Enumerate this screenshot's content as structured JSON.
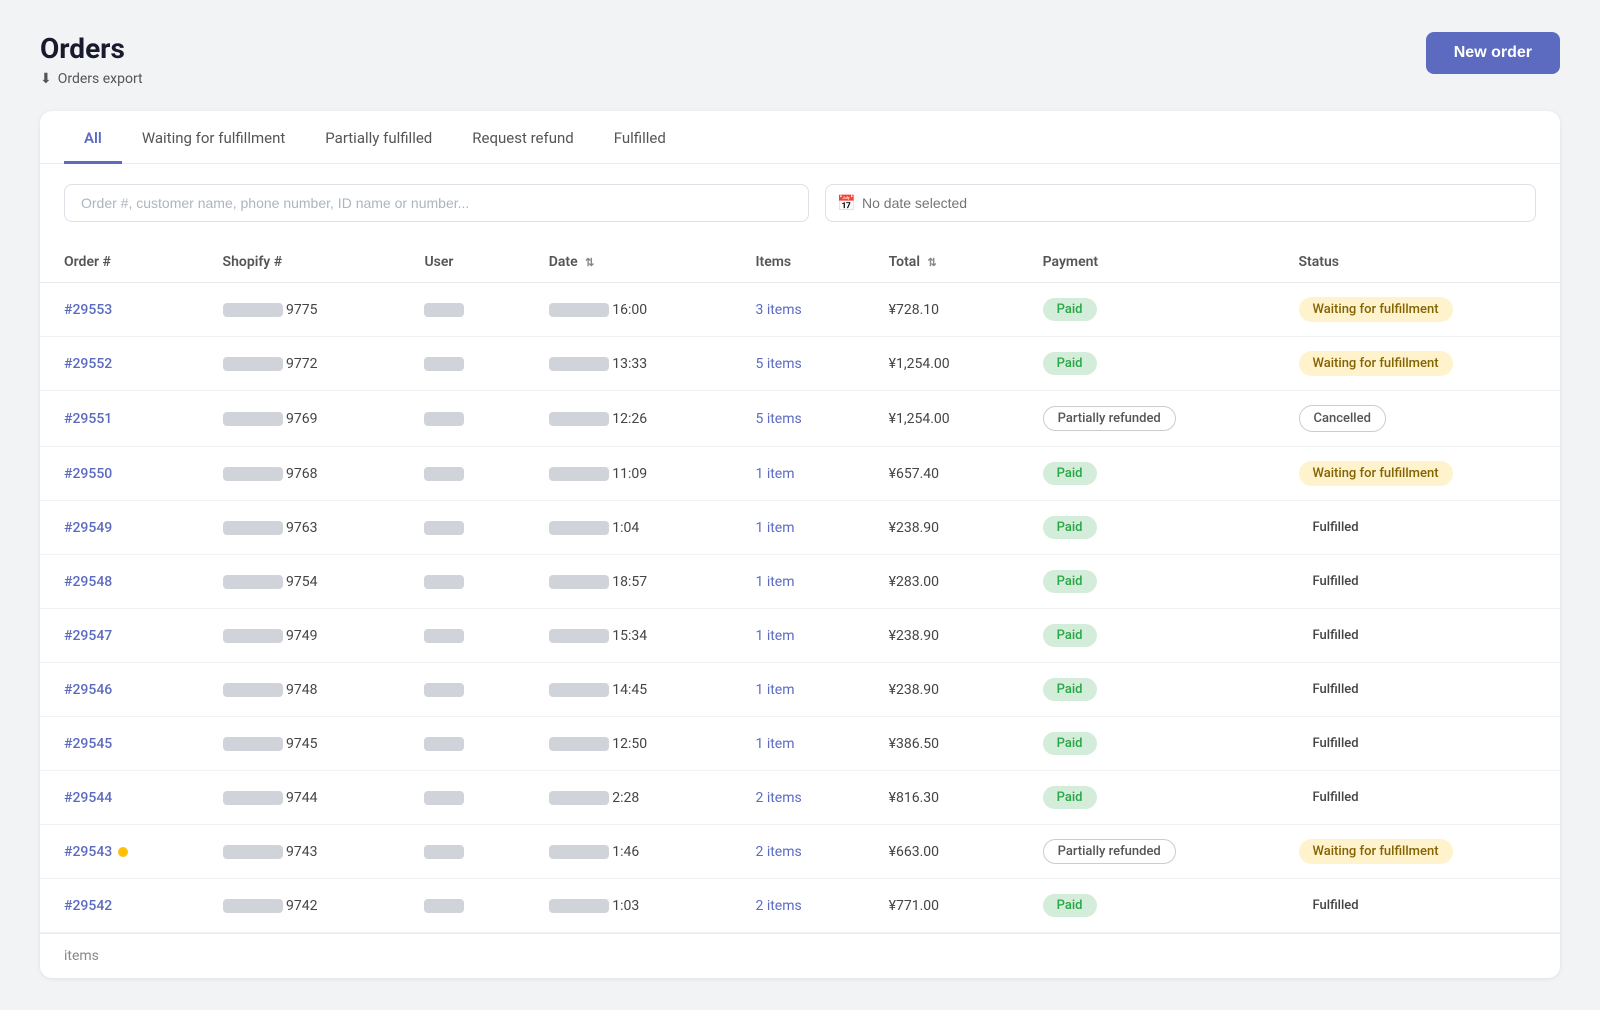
{
  "page": {
    "title": "Orders",
    "export_label": "Orders export",
    "new_order_label": "New order"
  },
  "tabs": [
    {
      "id": "all",
      "label": "All",
      "active": true
    },
    {
      "id": "waiting",
      "label": "Waiting for fulfillment",
      "active": false
    },
    {
      "id": "partial",
      "label": "Partially fulfilled",
      "active": false
    },
    {
      "id": "refund",
      "label": "Request refund",
      "active": false
    },
    {
      "id": "fulfilled",
      "label": "Fulfilled",
      "active": false
    }
  ],
  "filters": {
    "search_placeholder": "Order #, customer name, phone number, ID name or number...",
    "date_placeholder": "No date selected"
  },
  "table": {
    "columns": [
      {
        "id": "order",
        "label": "Order #",
        "sortable": false
      },
      {
        "id": "shopify",
        "label": "Shopify #",
        "sortable": false
      },
      {
        "id": "user",
        "label": "User",
        "sortable": false
      },
      {
        "id": "date",
        "label": "Date",
        "sortable": true
      },
      {
        "id": "items",
        "label": "Items",
        "sortable": false
      },
      {
        "id": "total",
        "label": "Total",
        "sortable": true
      },
      {
        "id": "payment",
        "label": "Payment",
        "sortable": false
      },
      {
        "id": "status",
        "label": "Status",
        "sortable": false
      }
    ],
    "rows": [
      {
        "order": "#29553",
        "shopify_suffix": "9775",
        "time": "16:00",
        "items": "3 items",
        "total": "¥728.10",
        "payment": "Paid",
        "payment_type": "paid",
        "status": "Waiting for fulfillment",
        "status_type": "waiting",
        "badge": false
      },
      {
        "order": "#29552",
        "shopify_suffix": "9772",
        "time": "13:33",
        "items": "5 items",
        "total": "¥1,254.00",
        "payment": "Paid",
        "payment_type": "paid",
        "status": "Waiting for fulfillment",
        "status_type": "waiting",
        "badge": false
      },
      {
        "order": "#29551",
        "shopify_suffix": "9769",
        "time": "12:26",
        "items": "5 items",
        "total": "¥1,254.00",
        "payment": "Partially refunded",
        "payment_type": "partial",
        "status": "Cancelled",
        "status_type": "cancelled",
        "badge": false
      },
      {
        "order": "#29550",
        "shopify_suffix": "9768",
        "time": "11:09",
        "items": "1 item",
        "total": "¥657.40",
        "payment": "Paid",
        "payment_type": "paid",
        "status": "Waiting for fulfillment",
        "status_type": "waiting",
        "badge": false
      },
      {
        "order": "#29549",
        "shopify_suffix": "9763",
        "time": "1:04",
        "items": "1 item",
        "total": "¥238.90",
        "payment": "Paid",
        "payment_type": "paid",
        "status": "Fulfilled",
        "status_type": "fulfilled",
        "badge": false
      },
      {
        "order": "#29548",
        "shopify_suffix": "9754",
        "time": "18:57",
        "items": "1 item",
        "total": "¥283.00",
        "payment": "Paid",
        "payment_type": "paid",
        "status": "Fulfilled",
        "status_type": "fulfilled",
        "badge": false
      },
      {
        "order": "#29547",
        "shopify_suffix": "9749",
        "time": "15:34",
        "items": "1 item",
        "total": "¥238.90",
        "payment": "Paid",
        "payment_type": "paid",
        "status": "Fulfilled",
        "status_type": "fulfilled",
        "badge": false
      },
      {
        "order": "#29546",
        "shopify_suffix": "9748",
        "time": "14:45",
        "items": "1 item",
        "total": "¥238.90",
        "payment": "Paid",
        "payment_type": "paid",
        "status": "Fulfilled",
        "status_type": "fulfilled",
        "badge": false
      },
      {
        "order": "#29545",
        "shopify_suffix": "9745",
        "time": "12:50",
        "items": "1 item",
        "total": "¥386.50",
        "payment": "Paid",
        "payment_type": "paid",
        "status": "Fulfilled",
        "status_type": "fulfilled",
        "badge": false
      },
      {
        "order": "#29544",
        "shopify_suffix": "9744",
        "time": "2:28",
        "items": "2 items",
        "total": "¥816.30",
        "payment": "Paid",
        "payment_type": "paid",
        "status": "Fulfilled",
        "status_type": "fulfilled",
        "badge": false
      },
      {
        "order": "#29543",
        "shopify_suffix": "9743",
        "time": "1:46",
        "items": "2 items",
        "total": "¥663.00",
        "payment": "Partially refunded",
        "payment_type": "partial",
        "status": "Waiting for fulfillment",
        "status_type": "waiting",
        "badge": true
      },
      {
        "order": "#29542",
        "shopify_suffix": "9742",
        "time": "1:03",
        "items": "2 items",
        "total": "¥771.00",
        "payment": "Paid",
        "payment_type": "paid",
        "status": "Fulfilled",
        "status_type": "fulfilled",
        "badge": false
      }
    ]
  },
  "pagination": {
    "items_label": "items"
  },
  "icons": {
    "download": "⬇",
    "calendar": "📅",
    "sort": "⇅"
  }
}
